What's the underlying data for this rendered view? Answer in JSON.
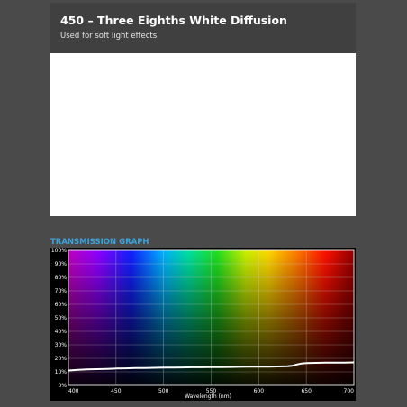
{
  "header": {
    "title": "450 – Three Eighths White Diffusion",
    "subtitle": "Used for soft light effects"
  },
  "swatch": {
    "color": "#ffffff"
  },
  "graph": {
    "heading": "TRANSMISSION GRAPH"
  },
  "chart_data": {
    "type": "line",
    "xlabel": "Wavelength (nm)",
    "ylabel": "",
    "xlim": [
      400,
      700
    ],
    "ylim": [
      0,
      100
    ],
    "x_ticks": [
      "400",
      "450",
      "500",
      "550",
      "600",
      "650",
      "700"
    ],
    "y_ticks": [
      "0%",
      "10%",
      "20%",
      "30%",
      "40%",
      "50%",
      "60%",
      "70%",
      "80%",
      "90%",
      "100%"
    ],
    "grid": true,
    "background": "visible spectrum gradient",
    "series": [
      {
        "color": "#ffffff",
        "x": [
          400,
          410,
          420,
          430,
          440,
          450,
          460,
          470,
          480,
          490,
          500,
          510,
          520,
          530,
          540,
          550,
          560,
          570,
          580,
          590,
          600,
          610,
          620,
          630,
          635,
          640,
          645,
          650,
          660,
          670,
          680,
          690,
          700
        ],
        "values": [
          11,
          11.5,
          11.8,
          12,
          12.2,
          12.5,
          12.6,
          12.8,
          12.9,
          13,
          13.1,
          13.2,
          13.3,
          13.4,
          13.4,
          13.5,
          13.5,
          13.6,
          13.7,
          13.8,
          13.8,
          13.9,
          14,
          14.2,
          14.5,
          15.5,
          16.2,
          16.5,
          16.7,
          16.8,
          16.8,
          16.9,
          17
        ]
      }
    ]
  }
}
